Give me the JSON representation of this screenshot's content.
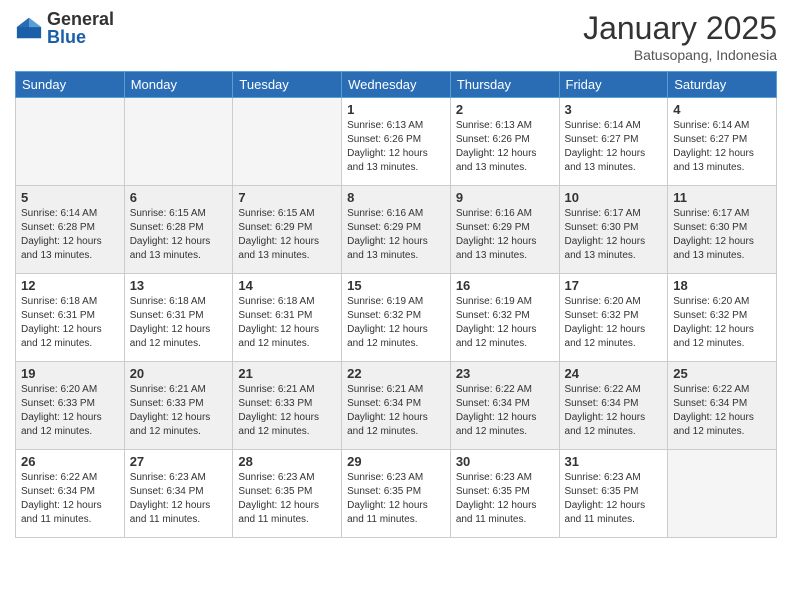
{
  "logo": {
    "general": "General",
    "blue": "Blue"
  },
  "title": "January 2025",
  "location": "Batusopang, Indonesia",
  "days_of_week": [
    "Sunday",
    "Monday",
    "Tuesday",
    "Wednesday",
    "Thursday",
    "Friday",
    "Saturday"
  ],
  "weeks": [
    [
      {
        "day": "",
        "empty": true
      },
      {
        "day": "",
        "empty": true
      },
      {
        "day": "",
        "empty": true
      },
      {
        "day": "1",
        "sunrise": "6:13 AM",
        "sunset": "6:26 PM",
        "daylight": "12 hours and 13 minutes."
      },
      {
        "day": "2",
        "sunrise": "6:13 AM",
        "sunset": "6:26 PM",
        "daylight": "12 hours and 13 minutes."
      },
      {
        "day": "3",
        "sunrise": "6:14 AM",
        "sunset": "6:27 PM",
        "daylight": "12 hours and 13 minutes."
      },
      {
        "day": "4",
        "sunrise": "6:14 AM",
        "sunset": "6:27 PM",
        "daylight": "12 hours and 13 minutes."
      }
    ],
    [
      {
        "day": "5",
        "sunrise": "6:14 AM",
        "sunset": "6:28 PM",
        "daylight": "12 hours and 13 minutes."
      },
      {
        "day": "6",
        "sunrise": "6:15 AM",
        "sunset": "6:28 PM",
        "daylight": "12 hours and 13 minutes."
      },
      {
        "day": "7",
        "sunrise": "6:15 AM",
        "sunset": "6:29 PM",
        "daylight": "12 hours and 13 minutes."
      },
      {
        "day": "8",
        "sunrise": "6:16 AM",
        "sunset": "6:29 PM",
        "daylight": "12 hours and 13 minutes."
      },
      {
        "day": "9",
        "sunrise": "6:16 AM",
        "sunset": "6:29 PM",
        "daylight": "12 hours and 13 minutes."
      },
      {
        "day": "10",
        "sunrise": "6:17 AM",
        "sunset": "6:30 PM",
        "daylight": "12 hours and 13 minutes."
      },
      {
        "day": "11",
        "sunrise": "6:17 AM",
        "sunset": "6:30 PM",
        "daylight": "12 hours and 13 minutes."
      }
    ],
    [
      {
        "day": "12",
        "sunrise": "6:18 AM",
        "sunset": "6:31 PM",
        "daylight": "12 hours and 12 minutes."
      },
      {
        "day": "13",
        "sunrise": "6:18 AM",
        "sunset": "6:31 PM",
        "daylight": "12 hours and 12 minutes."
      },
      {
        "day": "14",
        "sunrise": "6:18 AM",
        "sunset": "6:31 PM",
        "daylight": "12 hours and 12 minutes."
      },
      {
        "day": "15",
        "sunrise": "6:19 AM",
        "sunset": "6:32 PM",
        "daylight": "12 hours and 12 minutes."
      },
      {
        "day": "16",
        "sunrise": "6:19 AM",
        "sunset": "6:32 PM",
        "daylight": "12 hours and 12 minutes."
      },
      {
        "day": "17",
        "sunrise": "6:20 AM",
        "sunset": "6:32 PM",
        "daylight": "12 hours and 12 minutes."
      },
      {
        "day": "18",
        "sunrise": "6:20 AM",
        "sunset": "6:32 PM",
        "daylight": "12 hours and 12 minutes."
      }
    ],
    [
      {
        "day": "19",
        "sunrise": "6:20 AM",
        "sunset": "6:33 PM",
        "daylight": "12 hours and 12 minutes."
      },
      {
        "day": "20",
        "sunrise": "6:21 AM",
        "sunset": "6:33 PM",
        "daylight": "12 hours and 12 minutes."
      },
      {
        "day": "21",
        "sunrise": "6:21 AM",
        "sunset": "6:33 PM",
        "daylight": "12 hours and 12 minutes."
      },
      {
        "day": "22",
        "sunrise": "6:21 AM",
        "sunset": "6:34 PM",
        "daylight": "12 hours and 12 minutes."
      },
      {
        "day": "23",
        "sunrise": "6:22 AM",
        "sunset": "6:34 PM",
        "daylight": "12 hours and 12 minutes."
      },
      {
        "day": "24",
        "sunrise": "6:22 AM",
        "sunset": "6:34 PM",
        "daylight": "12 hours and 12 minutes."
      },
      {
        "day": "25",
        "sunrise": "6:22 AM",
        "sunset": "6:34 PM",
        "daylight": "12 hours and 12 minutes."
      }
    ],
    [
      {
        "day": "26",
        "sunrise": "6:22 AM",
        "sunset": "6:34 PM",
        "daylight": "12 hours and 11 minutes."
      },
      {
        "day": "27",
        "sunrise": "6:23 AM",
        "sunset": "6:34 PM",
        "daylight": "12 hours and 11 minutes."
      },
      {
        "day": "28",
        "sunrise": "6:23 AM",
        "sunset": "6:35 PM",
        "daylight": "12 hours and 11 minutes."
      },
      {
        "day": "29",
        "sunrise": "6:23 AM",
        "sunset": "6:35 PM",
        "daylight": "12 hours and 11 minutes."
      },
      {
        "day": "30",
        "sunrise": "6:23 AM",
        "sunset": "6:35 PM",
        "daylight": "12 hours and 11 minutes."
      },
      {
        "day": "31",
        "sunrise": "6:23 AM",
        "sunset": "6:35 PM",
        "daylight": "12 hours and 11 minutes."
      },
      {
        "day": "",
        "empty": true
      }
    ]
  ]
}
